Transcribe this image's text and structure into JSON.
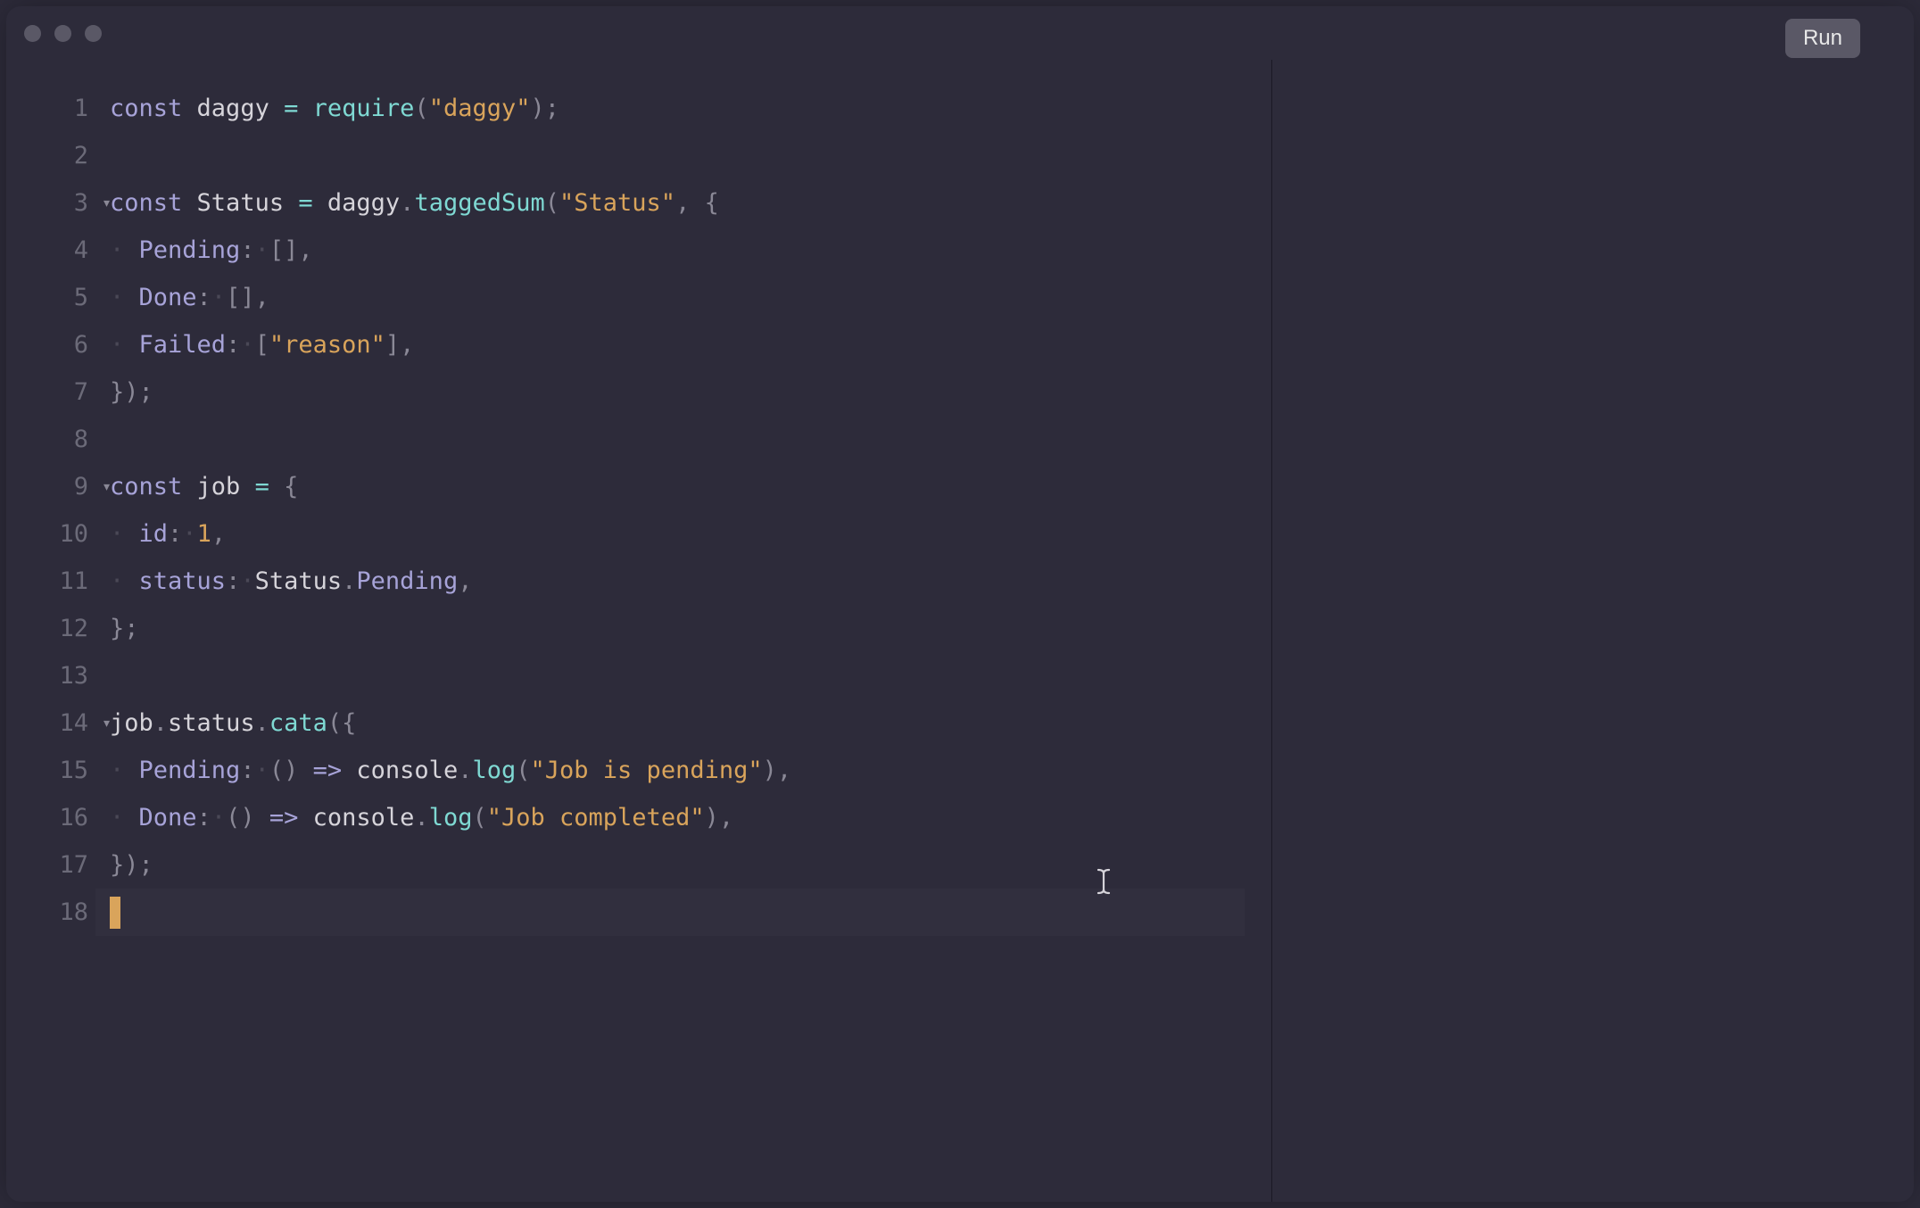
{
  "titlebar": {
    "run_label": "Run"
  },
  "editor": {
    "lines": [
      {
        "num": "1",
        "fold": false
      },
      {
        "num": "2",
        "fold": false
      },
      {
        "num": "3",
        "fold": true
      },
      {
        "num": "4",
        "fold": false
      },
      {
        "num": "5",
        "fold": false
      },
      {
        "num": "6",
        "fold": false
      },
      {
        "num": "7",
        "fold": false
      },
      {
        "num": "8",
        "fold": false
      },
      {
        "num": "9",
        "fold": true
      },
      {
        "num": "10",
        "fold": false
      },
      {
        "num": "11",
        "fold": false
      },
      {
        "num": "12",
        "fold": false
      },
      {
        "num": "13",
        "fold": false
      },
      {
        "num": "14",
        "fold": true
      },
      {
        "num": "15",
        "fold": false
      },
      {
        "num": "16",
        "fold": false
      },
      {
        "num": "17",
        "fold": false
      },
      {
        "num": "18",
        "fold": false
      }
    ],
    "code": {
      "l1": {
        "kw": "const",
        "var": "daggy",
        "op": "=",
        "fn": "require",
        "str": "\"daggy\"",
        "end": ";"
      },
      "l3": {
        "kw": "const",
        "var": "Status",
        "op": "=",
        "obj": "daggy",
        "dot": ".",
        "fn": "taggedSum",
        "str": "\"Status\"",
        "comma": ",",
        "brace": "{"
      },
      "l4": {
        "prop": "Pending",
        "colon": ":",
        "val": "[]",
        "comma": ","
      },
      "l5": {
        "prop": "Done",
        "colon": ":",
        "val": "[]",
        "comma": ","
      },
      "l6": {
        "prop": "Failed",
        "colon": ":",
        "lb": "[",
        "str": "\"reason\"",
        "rb": "]",
        "comma": ","
      },
      "l7": {
        "close": "});"
      },
      "l9": {
        "kw": "const",
        "var": "job",
        "op": "=",
        "brace": "{"
      },
      "l10": {
        "prop": "id",
        "colon": ":",
        "num": "1",
        "comma": ","
      },
      "l11": {
        "prop": "status",
        "colon": ":",
        "obj": "Status",
        "dot": ".",
        "member": "Pending",
        "comma": ","
      },
      "l12": {
        "close": "};"
      },
      "l14": {
        "obj1": "job",
        "dot1": ".",
        "prop1": "status",
        "dot2": ".",
        "fn": "cata",
        "open": "({"
      },
      "l15": {
        "prop": "Pending",
        "colon": ":",
        "arrow_l": "()",
        "arrow": "=>",
        "obj": "console",
        "dot": ".",
        "fn": "log",
        "str": "\"Job is pending\"",
        "comma": ","
      },
      "l16": {
        "prop": "Done",
        "colon": ":",
        "arrow_l": "()",
        "arrow": "=>",
        "obj": "console",
        "dot": ".",
        "fn": "log",
        "str": "\"Job completed\"",
        "comma": ","
      },
      "l17": {
        "close": "});"
      }
    }
  }
}
